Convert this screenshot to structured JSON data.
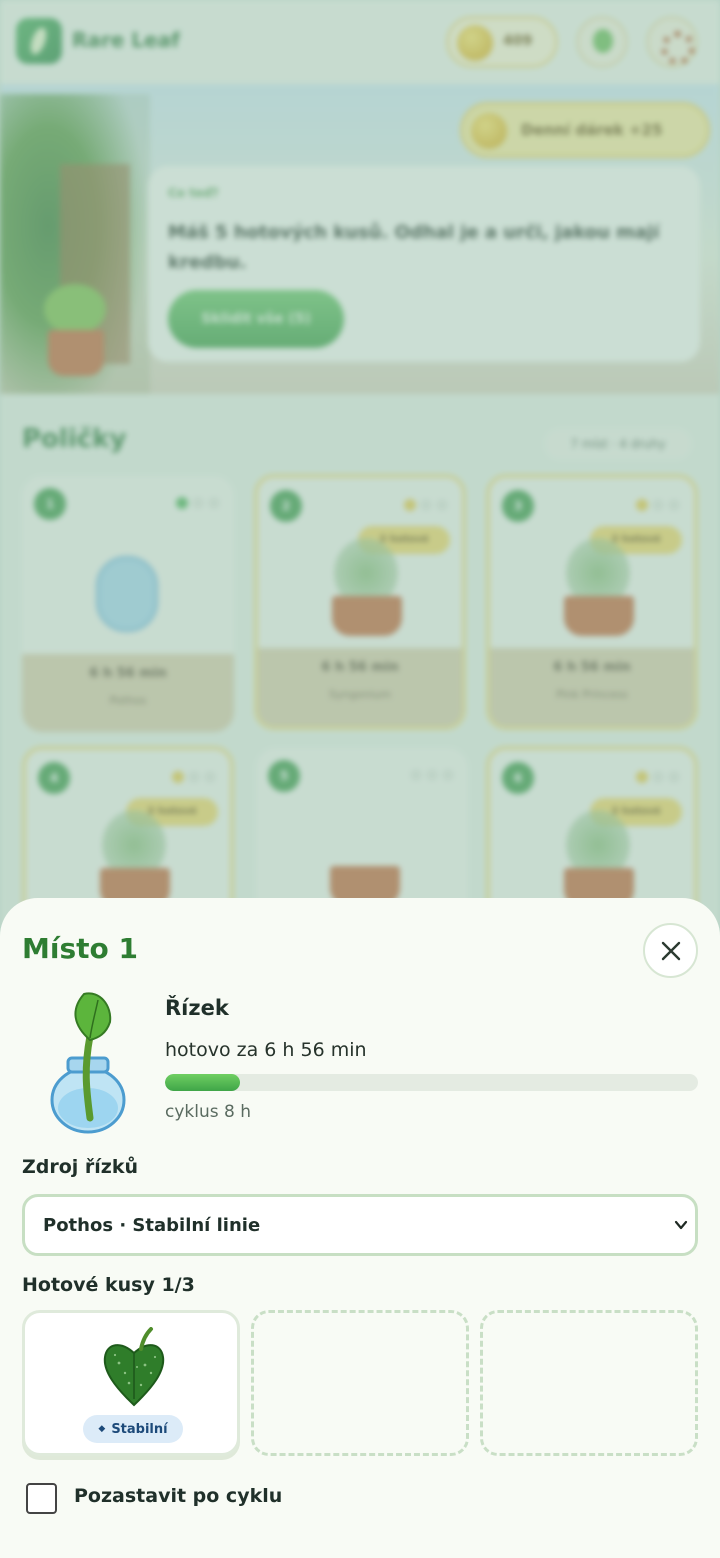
{
  "app": {
    "title": "Rare Leaf",
    "coins": "409",
    "daily_reward": "Denní dárek +25",
    "info_kicker": "Co teď?",
    "info_message": "Máš 5 hotových kusů. Odhal je a urči, jakou mají kredbu.",
    "collect_label": "Sklidit vše (5)",
    "section_title": "Poličky",
    "section_meta": "7 míst · 4 druhy",
    "slots": [
      {
        "num": "1",
        "footer_time": "6 h 56 min",
        "footer_name": "Pothos",
        "ready": ""
      },
      {
        "num": "2",
        "footer_time": "6 h 56 min",
        "footer_name": "Syngonium",
        "ready": "3 hotové"
      },
      {
        "num": "3",
        "footer_time": "6 h 56 min",
        "footer_name": "Pink Princess",
        "ready": "3 hotové"
      },
      {
        "num": "4",
        "footer_time": "",
        "footer_name": "",
        "ready": "3 hotové"
      },
      {
        "num": "5",
        "footer_time": "",
        "footer_name": "",
        "ready": ""
      },
      {
        "num": "6",
        "footer_time": "",
        "footer_name": "",
        "ready": "3 hotové"
      }
    ]
  },
  "sheet": {
    "title": "Místo 1",
    "stage_name": "Řízek",
    "ready_in": "hotovo za 6 h 56 min",
    "progress_fraction": 0.14,
    "cycle_text": "cyklus 8 h",
    "source_label": "Zdroj řízků",
    "source_selected": "Pothos · Stabilní linie",
    "pieces_label": "Hotové kusy 1/3",
    "piece_badge": "Stabilní",
    "pause_label": "Pozastavit po cyklu",
    "pause_checked": false
  },
  "colors": {
    "accent_green": "#2e7d32",
    "progress_green": "#4fb35a",
    "badge_blue": "#dcebf8"
  },
  "icons": {
    "close": "close-icon",
    "chevron": "chevron-down-icon",
    "leaf": "leaf-icon",
    "plant": "cutting-jar-icon"
  }
}
